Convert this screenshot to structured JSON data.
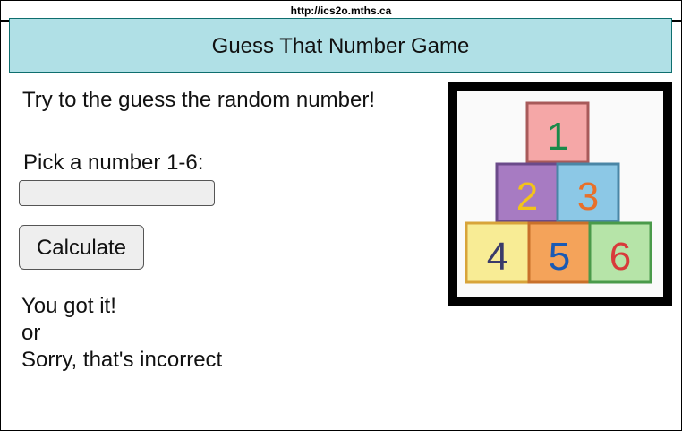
{
  "address_bar": {
    "url": "http://ics2o.mths.ca"
  },
  "header": {
    "title": "Guess That Number Game"
  },
  "main": {
    "instruction": "Try to the guess the random number!",
    "pick_label": "Pick a number 1-6:",
    "input_value": "",
    "calculate_label": "Calculate",
    "results": {
      "correct": "You got it!",
      "separator": "or",
      "incorrect": "Sorry, that's incorrect"
    }
  },
  "image": {
    "blocks": [
      "1",
      "2",
      "3",
      "4",
      "5",
      "6"
    ]
  },
  "colors": {
    "header_bg": "#b0e0e6",
    "header_border": "#0e6e6e",
    "control_bg": "#eeeeee"
  }
}
